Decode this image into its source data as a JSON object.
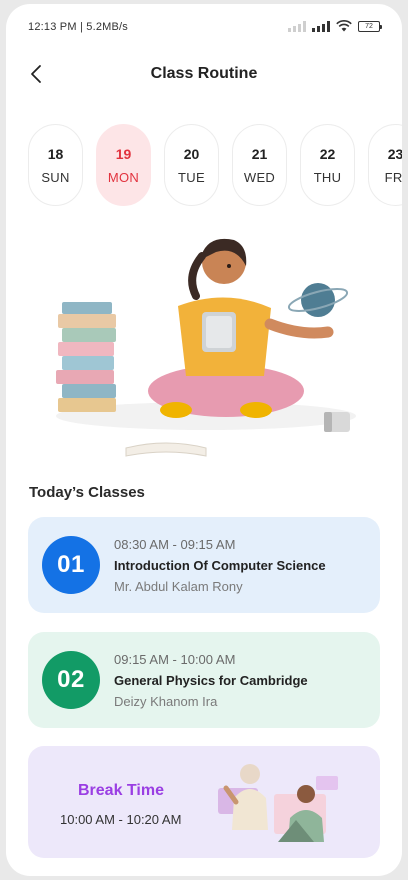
{
  "status": {
    "time_speed": "12:13 PM | 5.2MB/s",
    "battery": "72"
  },
  "header": {
    "title": "Class Routine"
  },
  "days": [
    {
      "num": "18",
      "name": "SUN"
    },
    {
      "num": "19",
      "name": "MON"
    },
    {
      "num": "20",
      "name": "TUE"
    },
    {
      "num": "21",
      "name": "WED"
    },
    {
      "num": "22",
      "name": "THU"
    },
    {
      "num": "23",
      "name": "FRI"
    }
  ],
  "active_day": "MON",
  "section": {
    "title": "Today’s Classes"
  },
  "classes": [
    {
      "index": "01",
      "time": "08:30 AM - 09:15 AM",
      "subject": "Introduction Of Computer Science",
      "teacher": "Mr. Abdul Kalam Rony"
    },
    {
      "index": "02",
      "time": "09:15 AM - 10:00 AM",
      "subject": "General Physics for Cambridge",
      "teacher": "Deizy Khanom Ira"
    }
  ],
  "break": {
    "title": "Break Time",
    "time": "10:00 AM - 10:20 AM"
  },
  "colors": {
    "active_day": "#e2333f",
    "class1_badge": "#1472e5",
    "class2_badge": "#129b66",
    "break_title": "#9a3ee3"
  }
}
